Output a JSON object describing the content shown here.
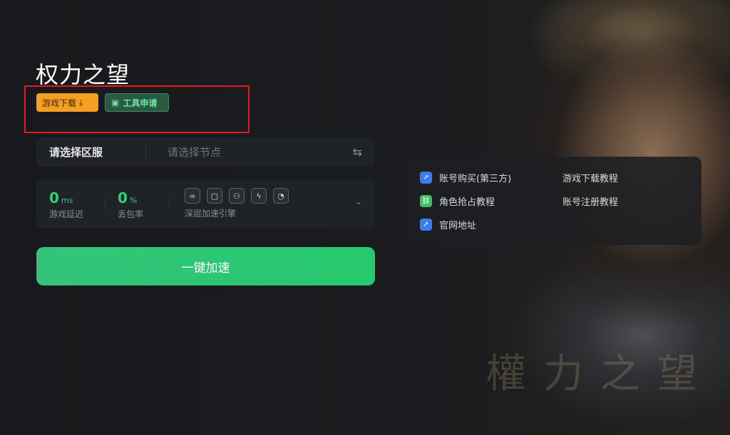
{
  "game": {
    "title": "权力之望"
  },
  "tags": {
    "download_label": "游戏下载",
    "tool_label": "工具申请"
  },
  "region": {
    "server_placeholder": "请选择区服",
    "node_placeholder": "请选择节点"
  },
  "stats": {
    "latency": {
      "value": "0",
      "unit": "ms",
      "label": "游戏延迟"
    },
    "loss": {
      "value": "0",
      "unit": "%",
      "label": "丢包率"
    },
    "engine_label": "深层加速引擎"
  },
  "accelerate_button": "一键加速",
  "links": [
    {
      "label": "账号购买(第三方)",
      "icon": "cursor-icon",
      "color": "#3d7cf0"
    },
    {
      "label": "游戏下载教程"
    },
    {
      "label": "角色抢占教程",
      "icon": "link-icon",
      "color": "#3dbf63"
    },
    {
      "label": "账号注册教程"
    },
    {
      "label": "官网地址",
      "icon": "cursor-icon",
      "color": "#3d7cf0"
    }
  ],
  "watermark": "權力之望",
  "colors": {
    "accent_green": "#2ecf78",
    "download_orange": "#f5a020",
    "highlight_red": "#e8191c"
  }
}
